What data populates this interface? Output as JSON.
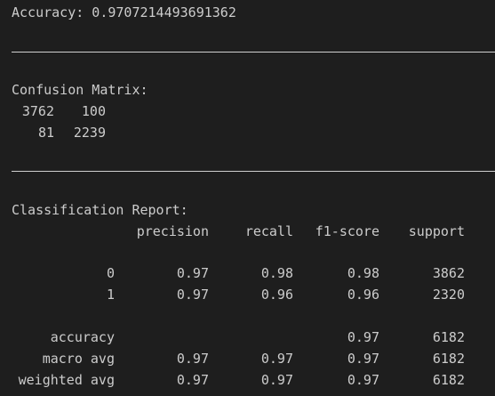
{
  "accuracy_line": "Accuracy: 0.9707214493691362",
  "confusion": {
    "title": "Confusion Matrix:",
    "rows": [
      [
        "3762",
        "100"
      ],
      [
        "81",
        "2239"
      ]
    ]
  },
  "report": {
    "title": "Classification Report:",
    "headers": [
      "precision",
      "recall",
      "f1-score",
      "support"
    ],
    "class_rows": [
      {
        "label": "0",
        "precision": "0.97",
        "recall": "0.98",
        "f1": "0.98",
        "support": "3862"
      },
      {
        "label": "1",
        "precision": "0.97",
        "recall": "0.96",
        "f1": "0.96",
        "support": "2320"
      }
    ],
    "summary_rows": [
      {
        "label": "accuracy",
        "precision": "",
        "recall": "",
        "f1": "0.97",
        "support": "6182"
      },
      {
        "label": "macro avg",
        "precision": "0.97",
        "recall": "0.97",
        "f1": "0.97",
        "support": "6182"
      },
      {
        "label": "weighted avg",
        "precision": "0.97",
        "recall": "0.97",
        "f1": "0.97",
        "support": "6182"
      }
    ]
  }
}
